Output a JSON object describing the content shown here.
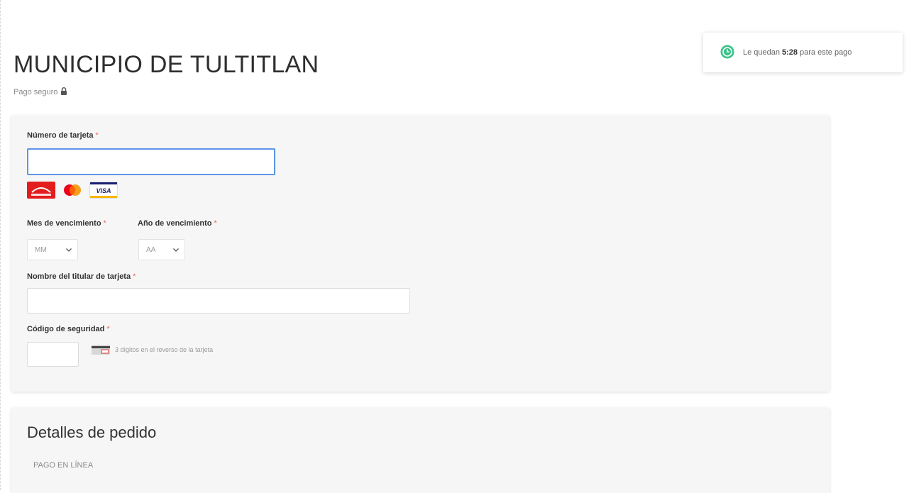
{
  "header": {
    "title": "MUNICIPIO DE TULTITLAN",
    "secure_label": "Pago seguro"
  },
  "timer": {
    "prefix": "Le quedan",
    "time": "5:28",
    "suffix": "para este pago"
  },
  "form": {
    "card_number": {
      "label": "Número de tarjeta",
      "required": "*",
      "value": ""
    },
    "brands": [
      "carnet-logo",
      "mastercard-logo",
      "visa-logo"
    ],
    "visa_text": "VISA",
    "exp_month": {
      "label": "Mes de vencimiento",
      "required": "*",
      "selected": "MM"
    },
    "exp_year": {
      "label": "Año de vencimiento",
      "required": "*",
      "selected": "AA"
    },
    "holder_name": {
      "label": "Nombre del titular de tarjeta",
      "required": "*",
      "value": ""
    },
    "security_code": {
      "label": "Código de seguridad",
      "required": "*",
      "value": "",
      "help": "3 dígitos en el reverso de la tarjeta"
    }
  },
  "order": {
    "title": "Detalles de pedido",
    "item": "PAGO EN LÍNEA"
  },
  "colors": {
    "accent": "#5a95e6",
    "required": "#e66666",
    "timer_icon": "#3cc28a",
    "card_bg": "#f6f6f6"
  }
}
